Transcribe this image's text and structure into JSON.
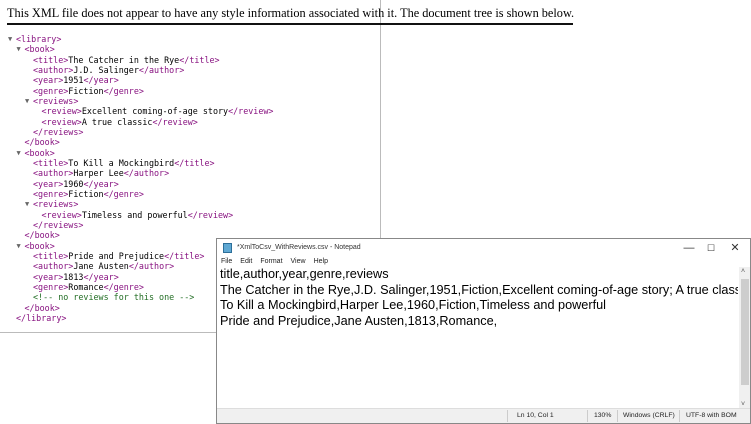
{
  "browser": {
    "notice": "This XML file does not appear to have any style information associated with it. The document tree is shown below.",
    "lines": [
      {
        "indent": 0,
        "toggle": "▼",
        "open": "<library>",
        "text": "",
        "close": ""
      },
      {
        "indent": 1,
        "toggle": "▼",
        "open": "<book>",
        "text": "",
        "close": ""
      },
      {
        "indent": 2,
        "toggle": "",
        "open": "<title>",
        "text": "The Catcher in the Rye",
        "close": "</title>"
      },
      {
        "indent": 2,
        "toggle": "",
        "open": "<author>",
        "text": "J.D. Salinger",
        "close": "</author>"
      },
      {
        "indent": 2,
        "toggle": "",
        "open": "<year>",
        "text": "1951",
        "close": "</year>"
      },
      {
        "indent": 2,
        "toggle": "",
        "open": "<genre>",
        "text": "Fiction",
        "close": "</genre>"
      },
      {
        "indent": 2,
        "toggle": "▼",
        "open": "<reviews>",
        "text": "",
        "close": ""
      },
      {
        "indent": 3,
        "toggle": "",
        "open": "<review>",
        "text": "Excellent coming-of-age story",
        "close": "</review>"
      },
      {
        "indent": 3,
        "toggle": "",
        "open": "<review>",
        "text": "A true classic",
        "close": "</review>"
      },
      {
        "indent": 2,
        "toggle": "",
        "open": "</reviews>",
        "text": "",
        "close": ""
      },
      {
        "indent": 1,
        "toggle": "",
        "open": "</book>",
        "text": "",
        "close": ""
      },
      {
        "indent": 1,
        "toggle": "▼",
        "open": "<book>",
        "text": "",
        "close": ""
      },
      {
        "indent": 2,
        "toggle": "",
        "open": "<title>",
        "text": "To Kill a Mockingbird",
        "close": "</title>"
      },
      {
        "indent": 2,
        "toggle": "",
        "open": "<author>",
        "text": "Harper Lee",
        "close": "</author>"
      },
      {
        "indent": 2,
        "toggle": "",
        "open": "<year>",
        "text": "1960",
        "close": "</year>"
      },
      {
        "indent": 2,
        "toggle": "",
        "open": "<genre>",
        "text": "Fiction",
        "close": "</genre>"
      },
      {
        "indent": 2,
        "toggle": "▼",
        "open": "<reviews>",
        "text": "",
        "close": ""
      },
      {
        "indent": 3,
        "toggle": "",
        "open": "<review>",
        "text": "Timeless and powerful",
        "close": "</review>"
      },
      {
        "indent": 2,
        "toggle": "",
        "open": "</reviews>",
        "text": "",
        "close": ""
      },
      {
        "indent": 1,
        "toggle": "",
        "open": "</book>",
        "text": "",
        "close": ""
      },
      {
        "indent": 1,
        "toggle": "▼",
        "open": "<book>",
        "text": "",
        "close": ""
      },
      {
        "indent": 2,
        "toggle": "",
        "open": "<title>",
        "text": "Pride and Prejudice",
        "close": "</title>"
      },
      {
        "indent": 2,
        "toggle": "",
        "open": "<author>",
        "text": "Jane Austen",
        "close": "</author>"
      },
      {
        "indent": 2,
        "toggle": "",
        "open": "<year>",
        "text": "1813",
        "close": "</year>"
      },
      {
        "indent": 2,
        "toggle": "",
        "open": "<genre>",
        "text": "Romance",
        "close": "</genre>"
      },
      {
        "indent": 2,
        "toggle": "",
        "open": "",
        "text": "",
        "close": "",
        "comment": "<!--  no reviews for this one  -->"
      },
      {
        "indent": 1,
        "toggle": "",
        "open": "</book>",
        "text": "",
        "close": ""
      },
      {
        "indent": 0,
        "toggle": "",
        "open": "</library>",
        "text": "",
        "close": ""
      }
    ]
  },
  "notepad": {
    "title": "*XmlToCsv_WithReviews.csv - Notepad",
    "controls": {
      "minimize": "—",
      "maximize": "☐",
      "close": "✕"
    },
    "menu": [
      "File",
      "Edit",
      "Format",
      "View",
      "Help"
    ],
    "lines": [
      "title,author,year,genre,reviews",
      "The Catcher in the Rye,J.D. Salinger,1951,Fiction,Excellent coming-of-age story; A true classic",
      "To Kill a Mockingbird,Harper Lee,1960,Fiction,Timeless and powerful",
      "Pride and Prejudice,Jane Austen,1813,Romance,"
    ],
    "status": {
      "position": "Ln 10, Col 1",
      "zoom": "130%",
      "line_ending": "Windows (CRLF)",
      "encoding": "UTF-8 with BOM"
    }
  }
}
